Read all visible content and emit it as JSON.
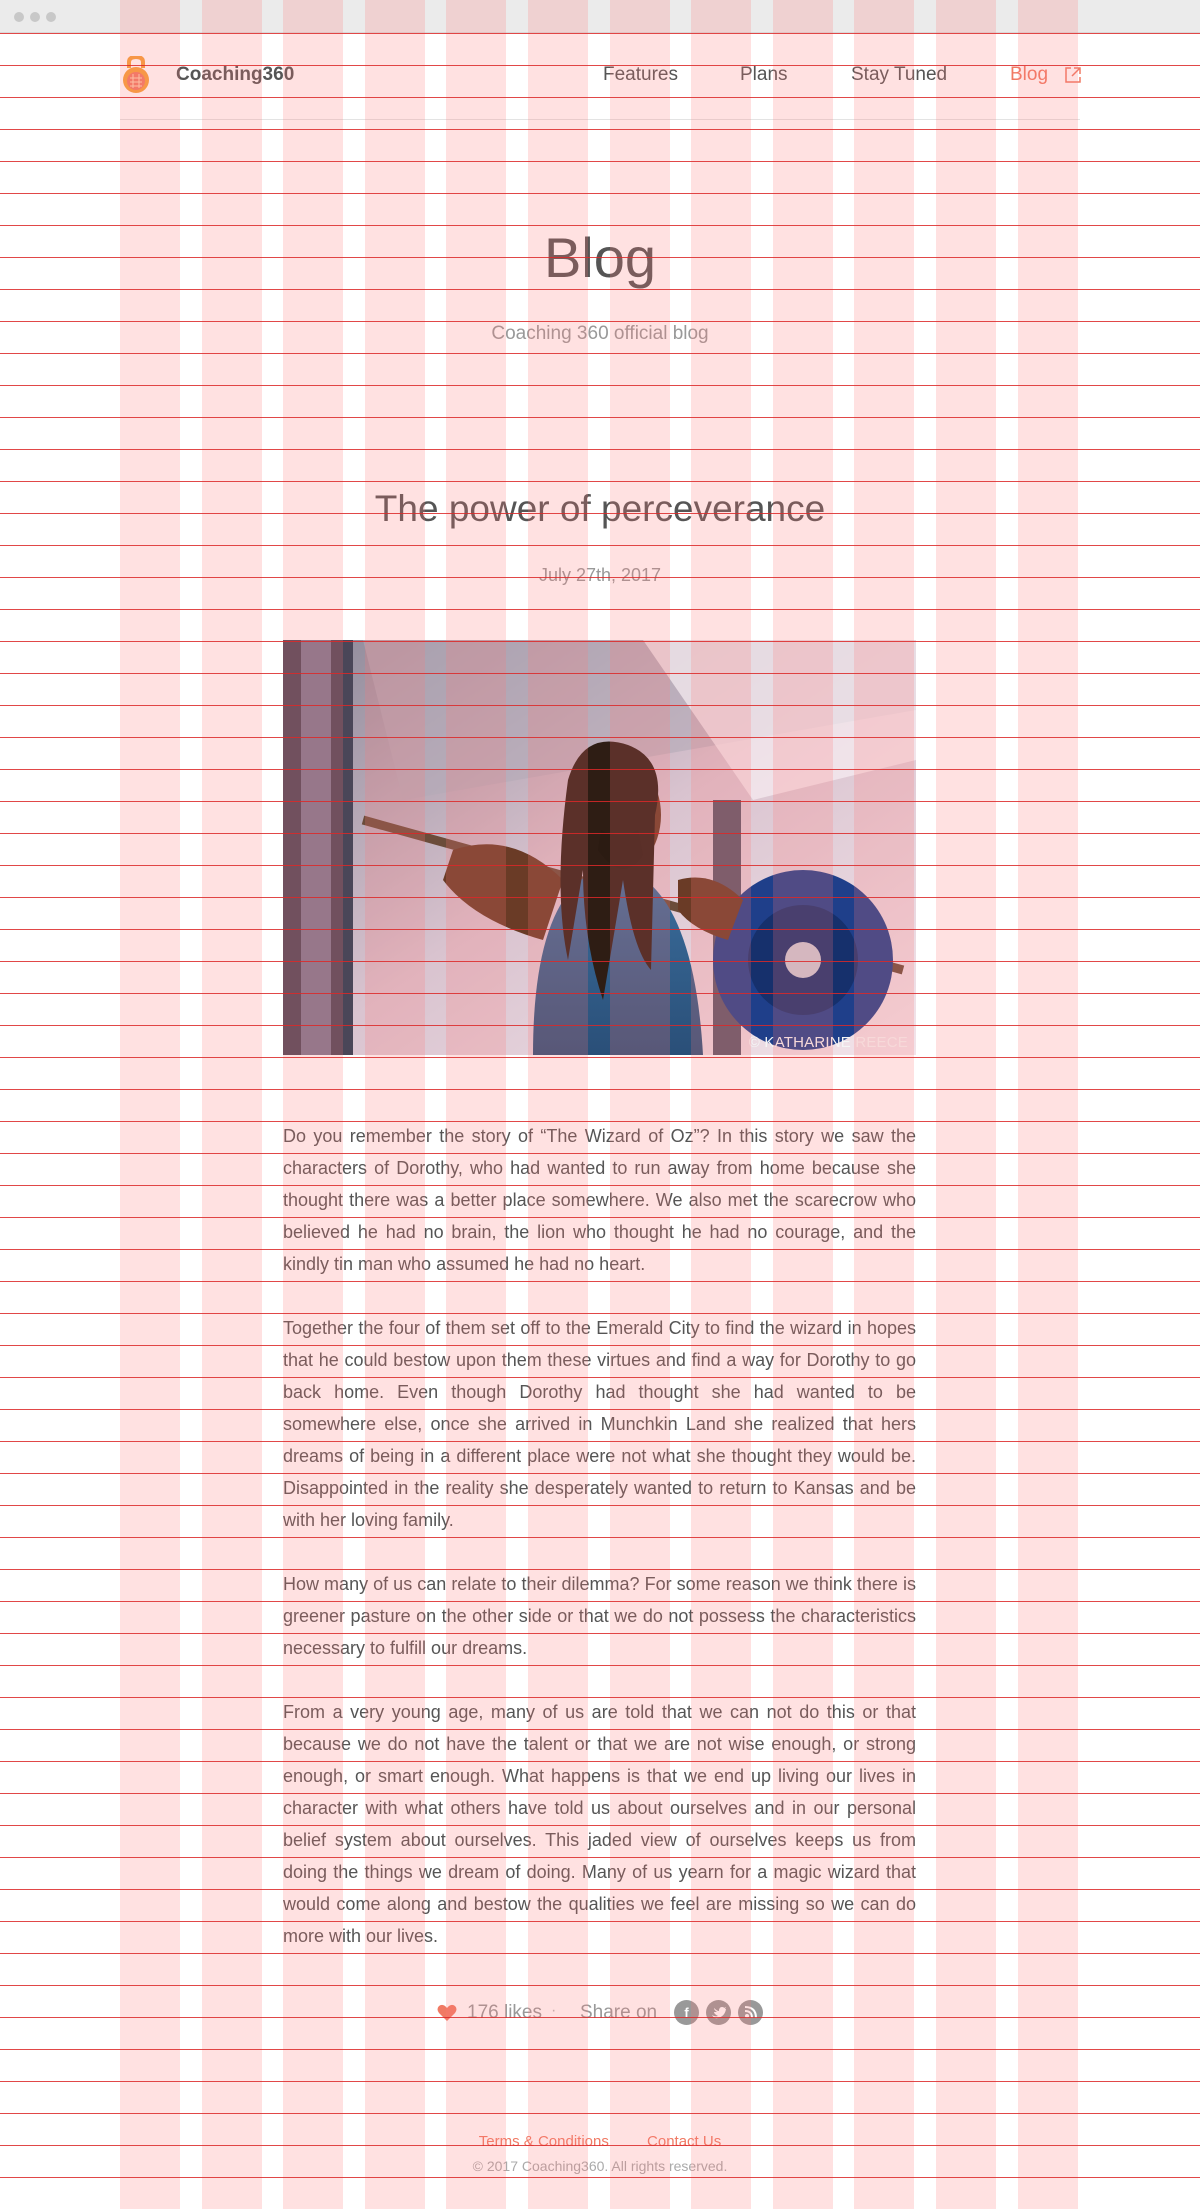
{
  "brand": {
    "name": "Coaching360"
  },
  "nav": {
    "items": [
      {
        "label": "Features"
      },
      {
        "label": "Plans"
      },
      {
        "label": "Stay Tuned"
      },
      {
        "label": "Blog"
      }
    ],
    "active": "Blog"
  },
  "page": {
    "title": "Blog",
    "subtitle": "Coaching 360 official blog"
  },
  "post": {
    "title": "The power of perceverance",
    "date": "July 27th, 2017",
    "image_credit": "© KATHARINE REECE",
    "paragraphs": [
      "Do you remember the story of “The Wizard of Oz”? In this story we saw the characters of Dorothy, who had wanted to run away from home because she thought there was a better place somewhere. We also met the scarecrow who believed he had no brain, the lion who thought he had no courage, and the kindly tin man who assumed he had no heart.",
      "Together the four of them set off to the Emerald City to find the wizard in hopes that he could bestow upon them these virtues and find a way for Dorothy to go back home. Even though Dorothy had thought she had wanted to be somewhere else, once she arrived in Munchkin Land she realized that hers dreams of being in a different place were not what she thought they would be. Disappointed in the reality she desperately wanted to return to Kansas and be with her loving family.",
      "How many of us can relate to their dilemma? For some reason we think there is greener pasture on the other side or that we do not possess the characteristics necessary to fulfill our dreams.",
      "From a very young age, many of us are told that we can not do this or that because we do not have the talent or that we are not wise enough, or strong enough, or smart enough. What happens is that we end up living our lives in character with what others have told us about ourselves and in our personal belief system about ourselves. This jaded view of ourselves keeps us from doing the things we dream of doing. Many of us yearn for a magic wizard that would come along and bestow the qualities we feel are missing so we can do more with our lives."
    ]
  },
  "social": {
    "likes": "176 likes",
    "separator": "·",
    "share_label": "Share on",
    "icons": [
      "facebook-icon",
      "twitter-icon",
      "rss-icon"
    ]
  },
  "footer": {
    "links": [
      "Terms & Conditions",
      "Contact Us"
    ],
    "copyright": "© 2017 Coaching360. All rights reserved."
  },
  "colors": {
    "accent": "#f07a64",
    "text": "#555555",
    "muted": "#999999",
    "logo_orange": "#f5a03a"
  }
}
